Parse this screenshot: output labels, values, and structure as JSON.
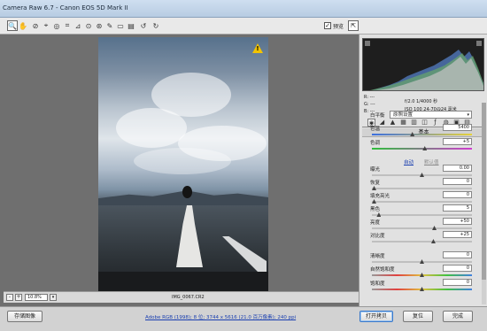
{
  "window": {
    "title": "Camera Raw 6.7 -  Canon EOS 5D Mark II"
  },
  "toolbar": {
    "tools": [
      {
        "name": "zoom-tool-icon",
        "glyph": "🔍"
      },
      {
        "name": "hand-tool-icon",
        "glyph": "✋"
      },
      {
        "name": "white-balance-tool-icon",
        "glyph": "⊘"
      },
      {
        "name": "color-sampler-icon",
        "glyph": "⌖"
      },
      {
        "name": "targeted-adjustment-icon",
        "glyph": "◎"
      },
      {
        "name": "crop-tool-icon",
        "glyph": "⌗"
      },
      {
        "name": "straighten-tool-icon",
        "glyph": "⊿"
      },
      {
        "name": "spot-removal-icon",
        "glyph": "⊙"
      },
      {
        "name": "red-eye-icon",
        "glyph": "⊛"
      },
      {
        "name": "adjustment-brush-icon",
        "glyph": "✎"
      },
      {
        "name": "graduated-filter-icon",
        "glyph": "▭"
      },
      {
        "name": "preferences-icon",
        "glyph": "▤"
      },
      {
        "name": "rotate-left-icon",
        "glyph": "↺"
      },
      {
        "name": "rotate-right-icon",
        "glyph": "↻"
      }
    ],
    "preview_checked": "✓",
    "preview_label": "预览",
    "fullscreen_glyph": "⇱"
  },
  "status": {
    "zoom_minus": "-",
    "zoom_plus": "+",
    "zoom_value": "10.8%",
    "zoom_arrow": "▾",
    "filename": "IMG_0067.CR2"
  },
  "info": {
    "r": "R:  ---",
    "g": "G:  ---",
    "b": "B:  ---",
    "exposure": "f/2.0   1/4000 秒",
    "iso": "ISO 100   24-70@24 毫米"
  },
  "panel": {
    "tabs": [
      {
        "name": "basic-tab-icon",
        "glyph": "◉"
      },
      {
        "name": "tone-curve-tab-icon",
        "glyph": "◢"
      },
      {
        "name": "detail-tab-icon",
        "glyph": "▲"
      },
      {
        "name": "hsl-tab-icon",
        "glyph": "▦"
      },
      {
        "name": "split-toning-tab-icon",
        "glyph": "▥"
      },
      {
        "name": "lens-tab-icon",
        "glyph": "◫"
      },
      {
        "name": "fx-tab-icon",
        "glyph": "ƒ"
      },
      {
        "name": "camera-calibration-tab-icon",
        "glyph": "◍"
      },
      {
        "name": "presets-tab-icon",
        "glyph": "▣"
      },
      {
        "name": "snapshots-tab-icon",
        "glyph": "▤"
      }
    ],
    "section_title": "基本",
    "white_balance_label": "白平衡",
    "white_balance_value": "原照设置",
    "white_balance_arrow": "▾",
    "auto_label": "自动",
    "default_label": "默认值",
    "rows": [
      {
        "label": "色温",
        "value": "5400",
        "pos": 0.4
      },
      {
        "label": "色调",
        "value": "+5",
        "pos": 0.53
      },
      {
        "label": "曝光",
        "value": "0.00",
        "pos": 0.5
      },
      {
        "label": "恢复",
        "value": "0",
        "pos": 0.0
      },
      {
        "label": "填充亮光",
        "value": "0",
        "pos": 0.0
      },
      {
        "label": "黑色",
        "value": "5",
        "pos": 0.05
      },
      {
        "label": "亮度",
        "value": "+50",
        "pos": 0.63
      },
      {
        "label": "对比度",
        "value": "+25",
        "pos": 0.62
      },
      {
        "label": "清晰度",
        "value": "0",
        "pos": 0.5
      },
      {
        "label": "自然饱和度",
        "value": "0",
        "pos": 0.5
      },
      {
        "label": "饱和度",
        "value": "0",
        "pos": 0.5
      }
    ]
  },
  "bottom": {
    "save_label": "存储图像",
    "workflow_link": "Adobe RGB (1998); 8 位; 3744 x 5616 (21.0 百万像素); 240 ppi",
    "open_label": "打开拷贝",
    "reset_label": "复位",
    "done_label": "完成"
  }
}
